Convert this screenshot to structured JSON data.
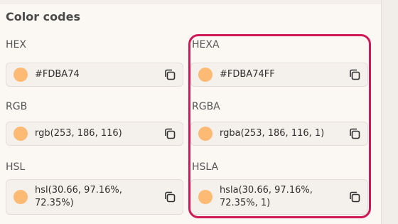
{
  "section": {
    "title": "Color codes"
  },
  "swatch_color": "#FDBA74",
  "highlight_color": "#D01A57",
  "fields": [
    {
      "label": "HEX",
      "value": "#FDBA74"
    },
    {
      "label": "HEXA",
      "value": "#FDBA74FF"
    },
    {
      "label": "RGB",
      "value": "rgb(253, 186, 116)"
    },
    {
      "label": "RGBA",
      "value": "rgba(253, 186, 116, 1)"
    },
    {
      "label": "HSL",
      "value": "hsl(30.66, 97.16%, 72.35%)"
    },
    {
      "label": "HSLA",
      "value": "hsla(30.66, 97.16%, 72.35%, 1)"
    }
  ],
  "icons": {
    "copy": "copy-icon"
  }
}
